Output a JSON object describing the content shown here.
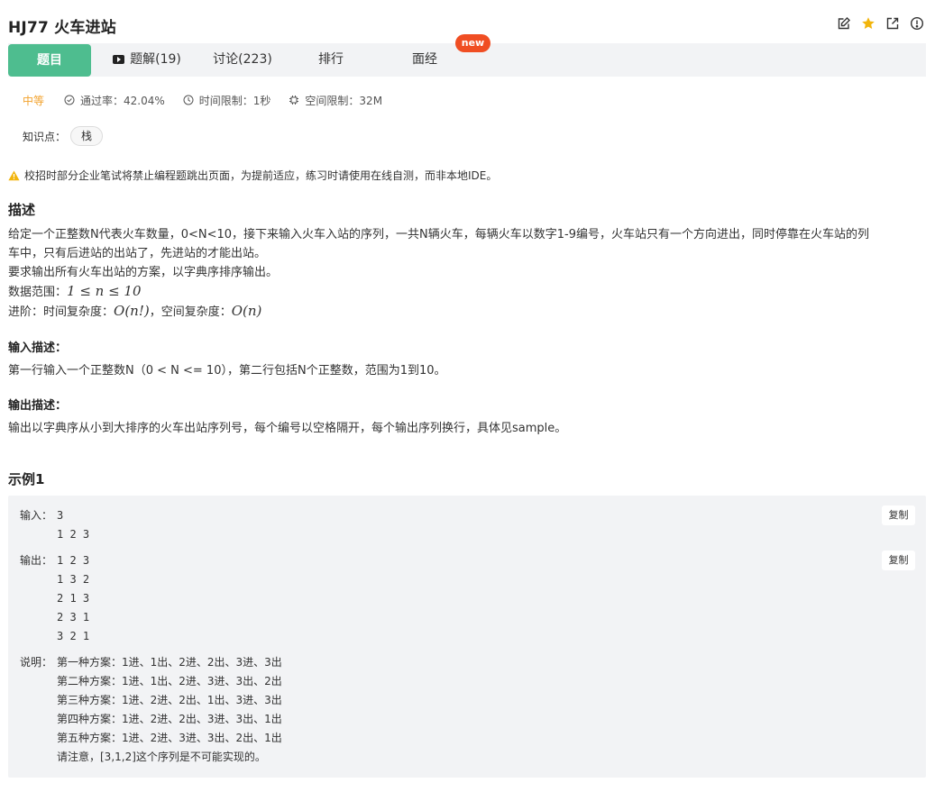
{
  "header": {
    "title": "HJ77  火车进站",
    "icons": [
      "edit-icon",
      "star-icon",
      "external-link-icon",
      "info-icon"
    ],
    "star_color": "#f2b50c"
  },
  "tabs": [
    {
      "label": "题目",
      "active": true
    },
    {
      "label": "题解(19)",
      "icon": "video-icon"
    },
    {
      "label": "讨论(223)"
    },
    {
      "label": "排行"
    },
    {
      "label": "面经"
    }
  ],
  "badge": "new",
  "meta": {
    "difficulty": "中等",
    "pass_rate": "通过率：42.04%",
    "time_limit": "时间限制：1秒",
    "space_limit": "空间限制：32M"
  },
  "knowledge": {
    "label": "知识点：",
    "tags": [
      "栈"
    ]
  },
  "warning": "校招时部分企业笔试将禁止编程题跳出页面，为提前适应，练习时请使用在线自测，而非本地IDE。",
  "description": {
    "heading": "描述",
    "line1": "给定一个正整数N代表火车数量，0<N<10，接下来输入火车入站的序列，一共N辆火车，每辆火车以数字1-9编号，火车站只有一个方向进出，同时停靠在火车站的列",
    "line2": "车中，只有后进站的出站了，先进站的才能出站。",
    "line3": "要求输出所有火车出站的方案，以字典序排序输出。",
    "range_label": "数据范围：",
    "range_math": "1 ≤ n ≤ 10",
    "adv_label": "进阶：时间复杂度：",
    "time_math": "O(n!)",
    "space_label": "，空间复杂度：",
    "space_math": "O(n)"
  },
  "input_desc": {
    "heading": "输入描述：",
    "text": "第一行输入一个正整数N（0 < N <= 10），第二行包括N个正整数，范围为1到10。"
  },
  "output_desc": {
    "heading": "输出描述：",
    "text": "输出以字典序从小到大排序的火车出站序列号，每个编号以空格隔开，每个输出序列换行，具体见sample。"
  },
  "example": {
    "heading": "示例1",
    "copy_label": "复制",
    "input_label": "输入：",
    "input_lines": [
      "3",
      "1 2 3"
    ],
    "output_label": "输出：",
    "output_lines": [
      "1 2 3",
      "1 3 2",
      "2 1 3",
      "2 3 1",
      "3 2 1"
    ],
    "explain_label": "说明：",
    "explain_lines": [
      "第一种方案：1进、1出、2进、2出、3进、3出",
      "第二种方案：1进、1出、2进、3进、3出、2出",
      "第三种方案：1进、2进、2出、1出、3进、3出",
      "第四种方案：1进、2进、2出、3进、3出、1出",
      "第五种方案：1进、2进、3进、3出、2出、1出",
      "请注意，[3,1,2]这个序列是不可能实现的。"
    ]
  }
}
